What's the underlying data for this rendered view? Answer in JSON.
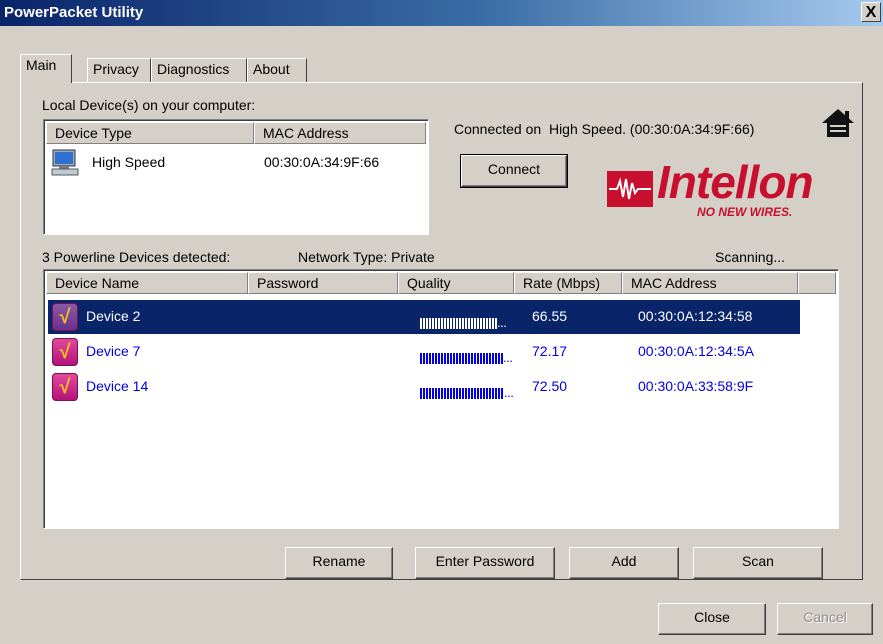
{
  "window": {
    "title": "PowerPacket Utility",
    "close_glyph": "X"
  },
  "tabs": [
    {
      "label": "Main",
      "active": true
    },
    {
      "label": "Privacy",
      "active": false
    },
    {
      "label": "Diagnostics",
      "active": false
    },
    {
      "label": "About",
      "active": false
    }
  ],
  "local": {
    "section_label": "Local Device(s) on your computer:",
    "columns": [
      "Device Type",
      "MAC Address"
    ],
    "devices": [
      {
        "type": "High Speed",
        "mac": "00:30:0A:34:9F:66",
        "icon": "computer-icon"
      }
    ],
    "status": "Connected on  High Speed. (00:30:0A:34:9F:66)",
    "connect_label": "Connect",
    "home_icon": "home-icon"
  },
  "brand": {
    "logo_text": "Intellon",
    "tagline": "NO NEW WIRES.",
    "logo_color": "#c8102e"
  },
  "network": {
    "detected_label": "3 Powerline Devices detected:",
    "type_label": "Network Type: Private",
    "scan_status": "Scanning...",
    "columns": [
      "Device Name",
      "Password",
      "Quality",
      "Rate (Mbps)",
      "MAC Address"
    ],
    "devices": [
      {
        "name": "Device 2",
        "password": "",
        "quality": 0.85,
        "rate": "66.55",
        "mac": "00:30:0A:12:34:58",
        "selected": true
      },
      {
        "name": "Device 7",
        "password": "",
        "quality": 0.92,
        "rate": "72.17",
        "mac": "00:30:0A:12:34:5A",
        "selected": false
      },
      {
        "name": "Device 14",
        "password": "",
        "quality": 0.93,
        "rate": "72.50",
        "mac": "00:30:0A:33:58:9F",
        "selected": false
      }
    ],
    "ellipsis": "..."
  },
  "actions": {
    "rename": "Rename",
    "enter_password": "Enter Password",
    "add": "Add",
    "scan": "Scan"
  },
  "footer": {
    "close": "Close",
    "cancel": "Cancel"
  },
  "colors": {
    "selection": "#0a246a",
    "link_blue": "#0000e0",
    "device_icon": "#c8177f"
  }
}
